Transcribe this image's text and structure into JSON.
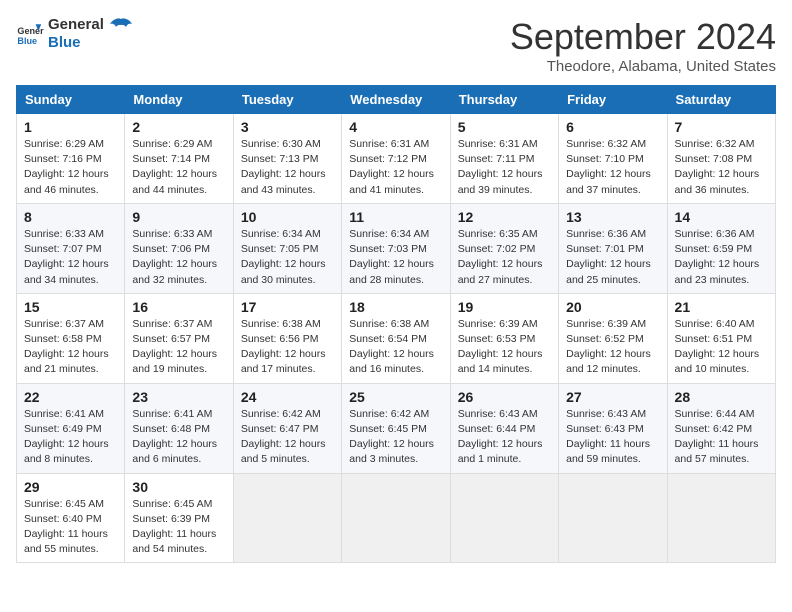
{
  "header": {
    "logo_line1": "General",
    "logo_line2": "Blue",
    "month": "September 2024",
    "location": "Theodore, Alabama, United States"
  },
  "days_of_week": [
    "Sunday",
    "Monday",
    "Tuesday",
    "Wednesday",
    "Thursday",
    "Friday",
    "Saturday"
  ],
  "weeks": [
    [
      {
        "day": "1",
        "sunrise": "6:29 AM",
        "sunset": "7:16 PM",
        "daylight": "12 hours and 46 minutes."
      },
      {
        "day": "2",
        "sunrise": "6:29 AM",
        "sunset": "7:14 PM",
        "daylight": "12 hours and 44 minutes."
      },
      {
        "day": "3",
        "sunrise": "6:30 AM",
        "sunset": "7:13 PM",
        "daylight": "12 hours and 43 minutes."
      },
      {
        "day": "4",
        "sunrise": "6:31 AM",
        "sunset": "7:12 PM",
        "daylight": "12 hours and 41 minutes."
      },
      {
        "day": "5",
        "sunrise": "6:31 AM",
        "sunset": "7:11 PM",
        "daylight": "12 hours and 39 minutes."
      },
      {
        "day": "6",
        "sunrise": "6:32 AM",
        "sunset": "7:10 PM",
        "daylight": "12 hours and 37 minutes."
      },
      {
        "day": "7",
        "sunrise": "6:32 AM",
        "sunset": "7:08 PM",
        "daylight": "12 hours and 36 minutes."
      }
    ],
    [
      {
        "day": "8",
        "sunrise": "6:33 AM",
        "sunset": "7:07 PM",
        "daylight": "12 hours and 34 minutes."
      },
      {
        "day": "9",
        "sunrise": "6:33 AM",
        "sunset": "7:06 PM",
        "daylight": "12 hours and 32 minutes."
      },
      {
        "day": "10",
        "sunrise": "6:34 AM",
        "sunset": "7:05 PM",
        "daylight": "12 hours and 30 minutes."
      },
      {
        "day": "11",
        "sunrise": "6:34 AM",
        "sunset": "7:03 PM",
        "daylight": "12 hours and 28 minutes."
      },
      {
        "day": "12",
        "sunrise": "6:35 AM",
        "sunset": "7:02 PM",
        "daylight": "12 hours and 27 minutes."
      },
      {
        "day": "13",
        "sunrise": "6:36 AM",
        "sunset": "7:01 PM",
        "daylight": "12 hours and 25 minutes."
      },
      {
        "day": "14",
        "sunrise": "6:36 AM",
        "sunset": "6:59 PM",
        "daylight": "12 hours and 23 minutes."
      }
    ],
    [
      {
        "day": "15",
        "sunrise": "6:37 AM",
        "sunset": "6:58 PM",
        "daylight": "12 hours and 21 minutes."
      },
      {
        "day": "16",
        "sunrise": "6:37 AM",
        "sunset": "6:57 PM",
        "daylight": "12 hours and 19 minutes."
      },
      {
        "day": "17",
        "sunrise": "6:38 AM",
        "sunset": "6:56 PM",
        "daylight": "12 hours and 17 minutes."
      },
      {
        "day": "18",
        "sunrise": "6:38 AM",
        "sunset": "6:54 PM",
        "daylight": "12 hours and 16 minutes."
      },
      {
        "day": "19",
        "sunrise": "6:39 AM",
        "sunset": "6:53 PM",
        "daylight": "12 hours and 14 minutes."
      },
      {
        "day": "20",
        "sunrise": "6:39 AM",
        "sunset": "6:52 PM",
        "daylight": "12 hours and 12 minutes."
      },
      {
        "day": "21",
        "sunrise": "6:40 AM",
        "sunset": "6:51 PM",
        "daylight": "12 hours and 10 minutes."
      }
    ],
    [
      {
        "day": "22",
        "sunrise": "6:41 AM",
        "sunset": "6:49 PM",
        "daylight": "12 hours and 8 minutes."
      },
      {
        "day": "23",
        "sunrise": "6:41 AM",
        "sunset": "6:48 PM",
        "daylight": "12 hours and 6 minutes."
      },
      {
        "day": "24",
        "sunrise": "6:42 AM",
        "sunset": "6:47 PM",
        "daylight": "12 hours and 5 minutes."
      },
      {
        "day": "25",
        "sunrise": "6:42 AM",
        "sunset": "6:45 PM",
        "daylight": "12 hours and 3 minutes."
      },
      {
        "day": "26",
        "sunrise": "6:43 AM",
        "sunset": "6:44 PM",
        "daylight": "12 hours and 1 minute."
      },
      {
        "day": "27",
        "sunrise": "6:43 AM",
        "sunset": "6:43 PM",
        "daylight": "11 hours and 59 minutes."
      },
      {
        "day": "28",
        "sunrise": "6:44 AM",
        "sunset": "6:42 PM",
        "daylight": "11 hours and 57 minutes."
      }
    ],
    [
      {
        "day": "29",
        "sunrise": "6:45 AM",
        "sunset": "6:40 PM",
        "daylight": "11 hours and 55 minutes."
      },
      {
        "day": "30",
        "sunrise": "6:45 AM",
        "sunset": "6:39 PM",
        "daylight": "11 hours and 54 minutes."
      },
      null,
      null,
      null,
      null,
      null
    ]
  ]
}
